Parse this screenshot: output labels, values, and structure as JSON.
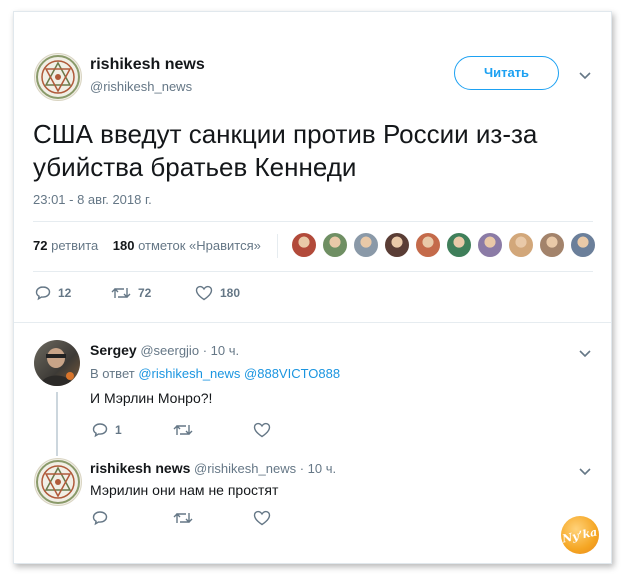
{
  "tweet": {
    "author_name": "rishikesh news",
    "author_handle": "@rishikesh_news",
    "follow_label": "Читать",
    "text_line1": "США введут санкции против России из-за",
    "text_line2": "убийства братьев Кеннеди",
    "timestamp": "23:01 - 8 авг. 2018 г.",
    "retweets_count": "72",
    "retweets_label": "ретвита",
    "likes_count": "180",
    "likes_label": "отметок «Нравится»",
    "actions": {
      "replies": "12",
      "retweets": "72",
      "likes": "180"
    },
    "liker_colors": [
      "#b24a3a",
      "#6f8f63",
      "#8a99a8",
      "#5a3d35",
      "#c46a4a",
      "#3f7f5a",
      "#8b7ba6",
      "#d2a77a",
      "#a3836b",
      "#6b7f9a"
    ]
  },
  "replies": [
    {
      "author_name": "Sergey",
      "author_handle": "@seergjio",
      "time": "· 10 ч.",
      "reply_prefix": "В ответ",
      "mention1": "@rishikesh_news",
      "mention2": "@888VICTO888",
      "text": "И Мэрлин Монро?!",
      "reply_count": "1"
    },
    {
      "author_name": "rishikesh news",
      "author_handle": "@rishikesh_news",
      "time": "· 10 ч.",
      "text": "Мэрилин они нам не простят"
    }
  ],
  "watermark": "Ny’ka",
  "colors": {
    "accent": "#1da1f2",
    "muted": "#657786",
    "watermark": "#f5a623"
  }
}
